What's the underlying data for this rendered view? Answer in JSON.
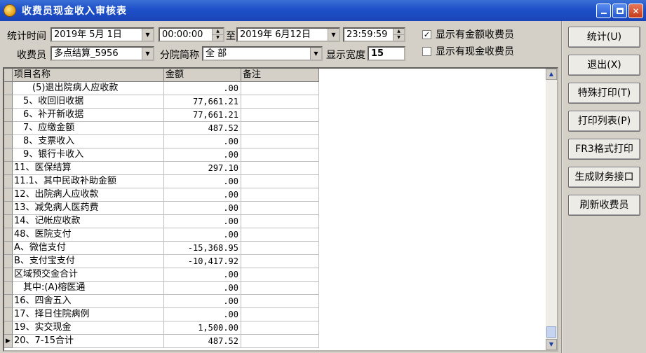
{
  "window": {
    "title": "收费员现金收入审核表"
  },
  "filters": {
    "stat_time_label": "统计时间",
    "start_date": "2019年  5月  1日",
    "start_time": "00:00:00",
    "to_label": "至",
    "end_date": "2019年  6月12日",
    "end_time": "23:59:59",
    "cashier_label": "收费员",
    "cashier_value": "多点结算_5956",
    "branch_label": "分院简称",
    "branch_value": "全  部",
    "width_label": "显示宽度",
    "width_value": "15",
    "show_amount_label": "显示有金额收费员",
    "show_amount_checked": true,
    "show_cash_label": "显示有现金收费员",
    "show_cash_checked": false
  },
  "table": {
    "columns": [
      "项目名称",
      "金额",
      "备注"
    ],
    "rows": [
      {
        "name": "　　(5)退出院病人应收款",
        "amount": ".00",
        "note": ""
      },
      {
        "name": "　5、收回旧收据",
        "amount": "77,661.21",
        "note": ""
      },
      {
        "name": "　6、补开新收据",
        "amount": "77,661.21",
        "note": ""
      },
      {
        "name": "　7、应缴金额",
        "amount": "487.52",
        "note": ""
      },
      {
        "name": "　8、支票收入",
        "amount": ".00",
        "note": ""
      },
      {
        "name": "　9、银行卡收入",
        "amount": ".00",
        "note": ""
      },
      {
        "name": "11、医保结算",
        "amount": "297.10",
        "note": ""
      },
      {
        "name": "11.1、其中民政补助金额",
        "amount": ".00",
        "note": ""
      },
      {
        "name": "12、出院病人应收款",
        "amount": ".00",
        "note": ""
      },
      {
        "name": "13、减免病人医药费",
        "amount": ".00",
        "note": ""
      },
      {
        "name": "14、记帐应收款",
        "amount": ".00",
        "note": ""
      },
      {
        "name": "48、医院支付",
        "amount": ".00",
        "note": ""
      },
      {
        "name": "A、微信支付",
        "amount": "-15,368.95",
        "note": ""
      },
      {
        "name": "B、支付宝支付",
        "amount": "-10,417.92",
        "note": ""
      },
      {
        "name": "区域预交金合计",
        "amount": ".00",
        "note": ""
      },
      {
        "name": "　其中:(A)榕医通",
        "amount": ".00",
        "note": ""
      },
      {
        "name": "16、四舍五入",
        "amount": ".00",
        "note": ""
      },
      {
        "name": "17、择日住院病例",
        "amount": ".00",
        "note": ""
      },
      {
        "name": "19、实交现金",
        "amount": "1,500.00",
        "note": ""
      },
      {
        "name": "20、7-15合计",
        "amount": "487.52",
        "note": ""
      }
    ]
  },
  "actions": [
    {
      "label": "统计(U)"
    },
    {
      "label": "退出(X)"
    },
    {
      "label": "特殊打印(T)"
    },
    {
      "label": "打印列表(P)"
    },
    {
      "label": "FR3格式打印"
    },
    {
      "label": "生成财务接口"
    },
    {
      "label": "刷新收费员"
    }
  ],
  "colors": {
    "titlebar": "#1e50c8",
    "panel": "#d4d0c8"
  }
}
